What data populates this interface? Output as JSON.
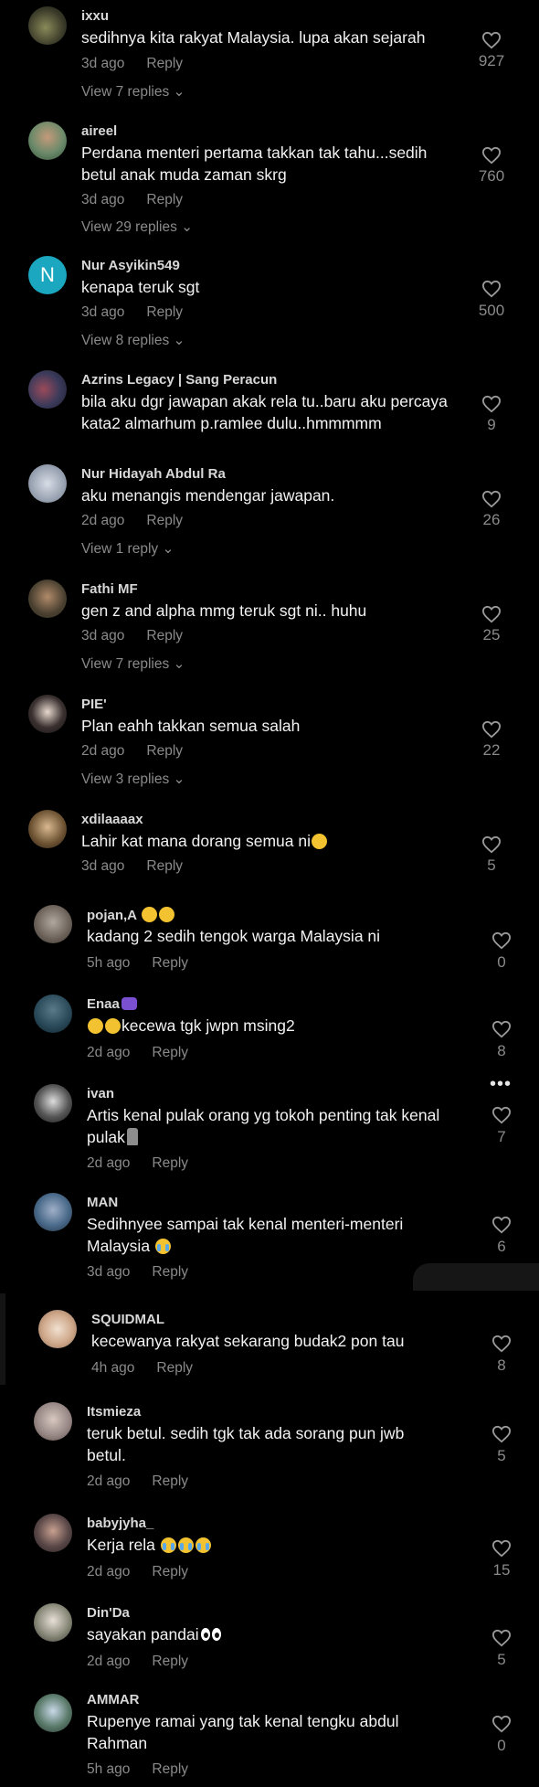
{
  "reply_label": "Reply",
  "comments": [
    {
      "username": "ixxu",
      "text": "sedihnya kita rakyat Malaysia. lupa akan sejarah",
      "time": "3d ago",
      "likes": "927",
      "replies": "View 7 replies",
      "avatar_icon": "avatar-photo"
    },
    {
      "username": "aireel",
      "text": "Perdana menteri pertama takkan tak tahu...sedih betul anak muda zaman skrg",
      "time": "3d ago",
      "likes": "760",
      "replies": "View 29 replies",
      "avatar_icon": "avatar-photo"
    },
    {
      "username": "Nur Asyikin549",
      "text": "kenapa teruk sgt",
      "time": "3d ago",
      "likes": "500",
      "replies": "View 8 replies",
      "avatar_letter": "N"
    },
    {
      "username": "Azrins Legacy | Sang Peracun",
      "text": "bila aku dgr jawapan akak rela tu..baru aku percaya kata2 almarhum p.ramlee dulu..hmmmmm",
      "likes": "9",
      "avatar_icon": "avatar-photo"
    },
    {
      "username": "Nur Hidayah Abdul Ra",
      "text": "aku menangis mendengar jawapan.",
      "time": "2d ago",
      "likes": "26",
      "replies": "View 1 reply",
      "avatar_icon": "avatar-photo"
    },
    {
      "username": "Fathi MF",
      "text": "gen z and alpha mmg teruk sgt ni.. huhu",
      "time": "3d ago",
      "likes": "25",
      "replies": "View 7 replies",
      "avatar_icon": "avatar-photo"
    },
    {
      "username": "PIE'",
      "text": "Plan eahh takkan semua salah",
      "time": "2d ago",
      "likes": "22",
      "replies": "View 3 replies",
      "avatar_icon": "avatar-photo"
    },
    {
      "username": "xdilaaaax",
      "text": "Lahir kat mana dorang semua ni",
      "time": "3d ago",
      "likes": "5",
      "avatar_icon": "avatar-photo",
      "emoji": "laughing-crying-emoji"
    },
    {
      "username": "pojan,A",
      "text": "kadang 2 sedih tengok warga Malaysia ni",
      "time": "5h ago",
      "likes": "0",
      "avatar_icon": "avatar-photo",
      "name_emoji": "upside-down-face-emoji"
    },
    {
      "username": "Enaa",
      "text": "kecewa tgk jwpn msing2",
      "time": "2d ago",
      "likes": "8",
      "avatar_icon": "avatar-photo",
      "emoji": "weary-face-emoji"
    },
    {
      "username": "ivan",
      "text": "Artis kenal pulak orang yg tokoh penting tak kenal pulak",
      "time": "2d ago",
      "likes": "7",
      "avatar_icon": "avatar-photo",
      "emoji": "moai-emoji"
    },
    {
      "username": "MAN",
      "text": "Sedihnyee sampai tak kenal menteri-menteri Malaysia",
      "time": "3d ago",
      "likes": "6",
      "avatar_icon": "avatar-photo",
      "emoji": "loudly-crying-emoji"
    },
    {
      "username": "SQUIDMAL",
      "text": "kecewanya rakyat sekarang budak2 pon tau",
      "time": "4h ago",
      "likes": "8",
      "avatar_icon": "avatar-photo"
    },
    {
      "username": "Itsmieza",
      "text": "teruk betul. sedih tgk tak ada sorang pun jwb betul.",
      "time": "2d ago",
      "likes": "5",
      "avatar_icon": "avatar-photo"
    },
    {
      "username": "babyjyha_",
      "text": "Kerja rela",
      "time": "2d ago",
      "likes": "15",
      "avatar_icon": "avatar-photo",
      "emoji": "loudly-crying-emoji"
    },
    {
      "username": "Din'Da",
      "text": "sayakan pandai",
      "time": "2d ago",
      "likes": "5",
      "avatar_icon": "avatar-photo",
      "emoji": "eyes-emoji"
    },
    {
      "username": "AMMAR",
      "text": "Rupenye ramai yang tak kenal tengku abdul Rahman",
      "time": "5h ago",
      "likes": "0",
      "avatar_icon": "avatar-photo"
    }
  ],
  "colors": {
    "background": "#000000",
    "text": "#f2f2f2",
    "secondary": "#8a8a8a",
    "letter_avatar": "#1aa7bf"
  }
}
